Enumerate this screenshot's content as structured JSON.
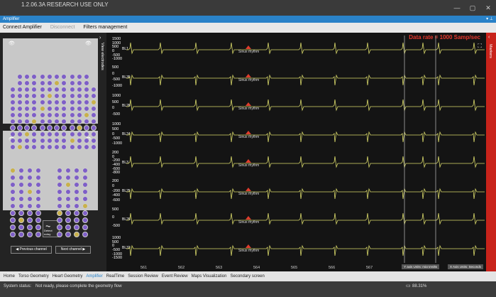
{
  "window": {
    "title": "1.2.06.3A  RESEARCH USE ONLY",
    "minimize": "—",
    "maximize": "▢",
    "close": "✕"
  },
  "appbar": {
    "title": "Amplifier"
  },
  "menu": {
    "connect": "Connect Amplifier",
    "disconnect": "Disconnect",
    "filters": "Filters management"
  },
  "left": {
    "view_electrodes": "View electrodes",
    "detect_label": "Detect noisy",
    "prev": "Previous channel",
    "next": "Next channel"
  },
  "plot": {
    "rate": "Data rate = 1000 Samp/sec",
    "annotation": "Sinus rhythm",
    "channels": [
      {
        "label": "BL1",
        "ticks": [
          "1500",
          "1000",
          "500",
          "0",
          "-500",
          "-1000"
        ]
      },
      {
        "label": "BL35",
        "ticks": [
          "500",
          "0",
          "-500",
          "-1000"
        ]
      },
      {
        "label": "BL28",
        "ticks": [
          "1000",
          "500",
          "0",
          "-500"
        ]
      },
      {
        "label": "BL24",
        "ticks": [
          "1000",
          "500",
          "0",
          "-500",
          "-1000"
        ]
      },
      {
        "label": "BL3",
        "ticks": [
          "200",
          "0",
          "-200",
          "-400",
          "-600",
          "-800"
        ]
      },
      {
        "label": "BL25",
        "ticks": [
          "200",
          "0",
          "-200",
          "-400",
          "-600"
        ]
      },
      {
        "label": "BL26",
        "ticks": [
          "500",
          "0",
          "-500"
        ]
      },
      {
        "label": "BL33",
        "ticks": [
          "1000",
          "500",
          "0",
          "-500",
          "-1000",
          "-1500"
        ]
      }
    ],
    "x_ticks": [
      "561",
      "562",
      "563",
      "564",
      "565",
      "566",
      "567"
    ],
    "y_units": "Y axis Units: microVolts",
    "x_units": "X Axis Units: Seconds"
  },
  "markers": {
    "label": "Markers"
  },
  "tabs": [
    "Home",
    "Torso Geometry",
    "Heart Geometry",
    "Amplifier",
    "RealTime",
    "Session Review",
    "Event Review",
    "Maps Visualization",
    "Secondary screen"
  ],
  "active_tab": "Amplifier",
  "status": {
    "label": "System status:",
    "message": "Not ready, please complete the geometry flow",
    "battery": "88.31%"
  }
}
